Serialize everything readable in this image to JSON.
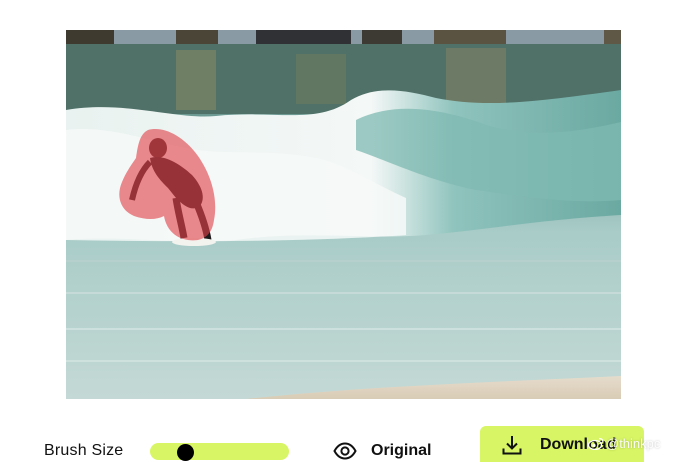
{
  "colors": {
    "accent": "#d7f564",
    "mask": "#e0424a",
    "text": "#111111"
  },
  "image": {
    "description_icon": "surfer-photo",
    "has_mask": true
  },
  "toolbar": {
    "brush_size_label": "Brush Size",
    "brush_size_value": 0.25,
    "original_label": "Original",
    "original_icon": "eye-icon",
    "download_label": "Download",
    "download_icon": "download-icon"
  },
  "watermark": {
    "text": "@thinkpc",
    "icon": "weibo-icon"
  }
}
